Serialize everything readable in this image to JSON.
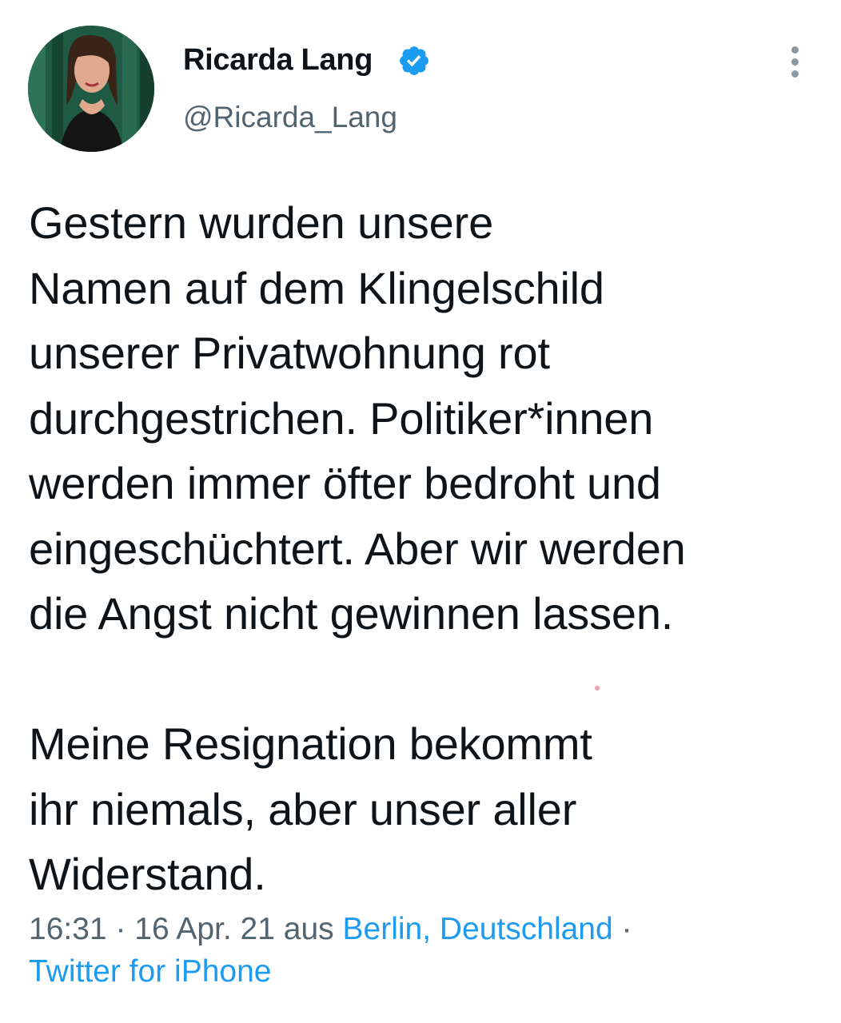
{
  "author": {
    "display_name": "Ricarda Lang",
    "handle": "@Ricarda_Lang",
    "verified": true,
    "avatar_icon": "profile-photo"
  },
  "tweet": {
    "lines_p1": [
      "Gestern wurden unsere",
      "Namen auf dem Klingelschild",
      "unserer Privatwohnung rot",
      "durchgestrichen. Politiker*innen",
      "werden immer öfter bedroht und",
      "eingeschüchtert. Aber wir werden",
      "die Angst nicht gewinnen lassen."
    ],
    "lines_p2": [
      "Meine Resignation bekommt",
      "ihr niemals, aber unser aller",
      "Widerstand."
    ]
  },
  "meta": {
    "time": "16:31",
    "sep1": " · ",
    "date": "16 Apr. 21",
    "aus": " aus ",
    "location": "Berlin, Deutschland",
    "sep2": " ·",
    "source": "Twitter for iPhone"
  },
  "colors": {
    "link": "#1d9bf0",
    "secondary_text": "#536471",
    "verified_badge": "#1d9bf0"
  },
  "icons": {
    "verified": "verified-badge-icon",
    "more": "more-vertical-icon"
  }
}
